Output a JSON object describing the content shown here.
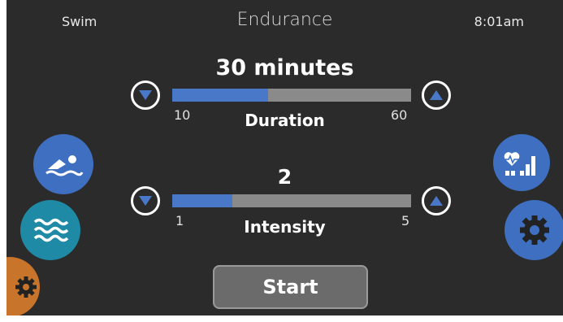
{
  "header": {
    "left": "Swim",
    "title": "Endurance",
    "time": "8:01am"
  },
  "duration": {
    "value_text": "30 minutes",
    "label": "Duration",
    "min": "10",
    "max": "60",
    "value": 30,
    "min_num": 10,
    "max_num": 60
  },
  "intensity": {
    "value_text": "2",
    "label": "Intensity",
    "min": "1",
    "max": "5",
    "value": 2,
    "min_num": 1,
    "max_num": 5
  },
  "start_button": {
    "label": "Start"
  },
  "icons": {
    "swim": "swimmer-icon",
    "water": "waves-icon",
    "settings_partial": "gear-icon",
    "heart_stats": "heart-rate-chart-icon",
    "settings": "gear-icon"
  },
  "colors": {
    "accent_blue": "#4a78c8",
    "teal": "#1f8aa6",
    "orange": "#c8742a",
    "track_gray": "#8a8a8a",
    "background": "#2b2b2b"
  }
}
